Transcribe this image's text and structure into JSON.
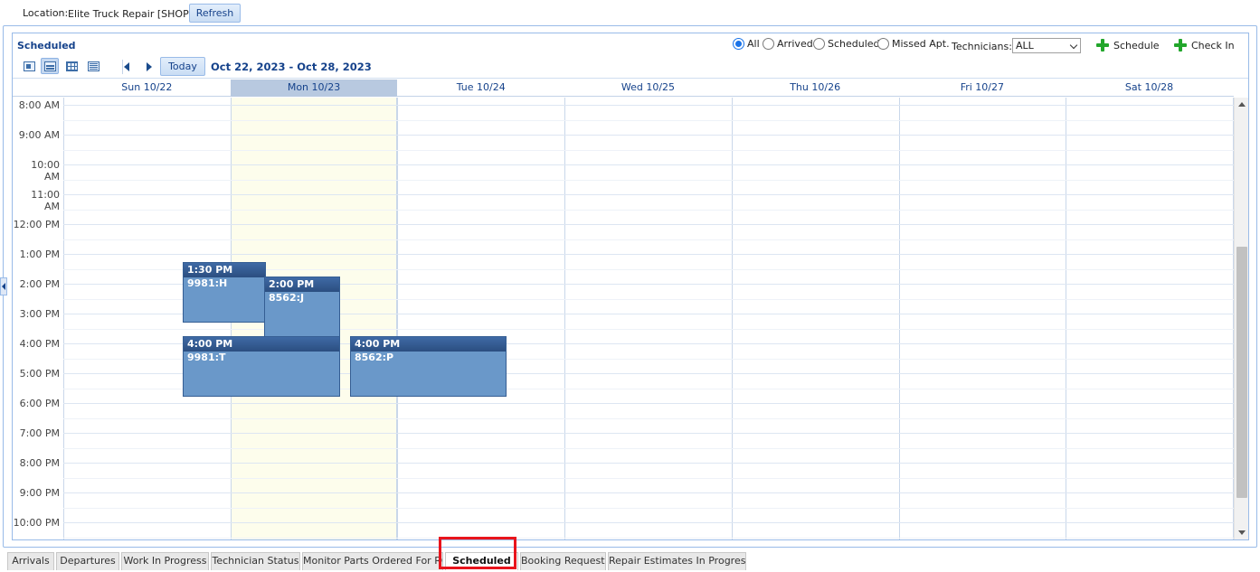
{
  "location": {
    "label": "Location:",
    "value": "Elite Truck Repair [SHOP]",
    "refresh_label": "Refresh"
  },
  "panel": {
    "title": "Scheduled",
    "view_icons": [
      "day-view-icon",
      "week-view-icon",
      "month-view-icon",
      "list-view-icon"
    ],
    "today_label": "Today",
    "date_range": "Oct 22, 2023 - Oct 28, 2023"
  },
  "filters": {
    "options": [
      "All",
      "Arrived",
      "Scheduled",
      "Missed Apt."
    ],
    "selected": "All",
    "technicians_label": "Technicians:",
    "technicians_value": "ALL",
    "schedule_label": "Schedule",
    "checkin_label": "Check In"
  },
  "days": [
    "Sun 10/22",
    "Mon 10/23",
    "Tue 10/24",
    "Wed 10/25",
    "Thu 10/26",
    "Fri 10/27",
    "Sat 10/28"
  ],
  "today_index": 1,
  "time_labels": [
    "8:00 AM",
    "9:00 AM",
    "10:00 AM",
    "11:00 AM",
    "12:00 PM",
    "1:00 PM",
    "2:00 PM",
    "3:00 PM",
    "4:00 PM",
    "5:00 PM",
    "6:00 PM",
    "7:00 PM",
    "8:00 PM",
    "9:00 PM",
    "10:00 PM"
  ],
  "events": [
    {
      "time": "1:30 PM",
      "title": "9981:H"
    },
    {
      "time": "2:00 PM",
      "title": "8562:J"
    },
    {
      "time": "4:00 PM",
      "title": "9981:T"
    },
    {
      "time": "4:00 PM",
      "title": "8562:P"
    }
  ],
  "tabs": [
    "Arrivals",
    "Departures",
    "Work In Progress",
    "Technician Status",
    "Monitor Parts Ordered For RO",
    "Scheduled",
    "Booking Requests",
    "Repair Estimates In Progress"
  ],
  "active_tab": "Scheduled",
  "colors": {
    "accent": "#15428b",
    "event_fill": "#6a98c9",
    "event_header": "#2b4e80",
    "today_column": "#fdfdec",
    "highlight": "#e8141c",
    "add_icon": "#22a62b"
  }
}
